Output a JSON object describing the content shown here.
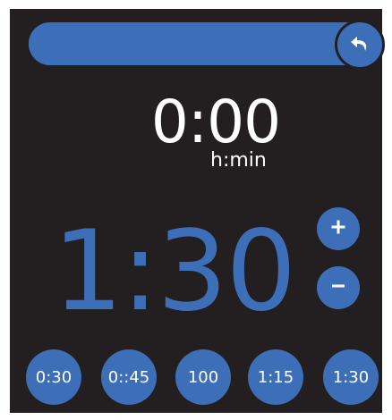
{
  "timer": {
    "elapsed": "0:00",
    "elapsed_unit": "h:min",
    "setpoint": "1:30",
    "progress_fraction": 1.0
  },
  "controls": {
    "back_icon": "undo-arrow-icon",
    "plus_icon": "plus-icon",
    "minus_icon": "minus-icon"
  },
  "presets": [
    "0:30",
    "0::45",
    "100",
    "1:15",
    "1:30"
  ],
  "colors": {
    "background": "#231f20",
    "accent": "#3d6fb8",
    "text": "#ffffff"
  }
}
